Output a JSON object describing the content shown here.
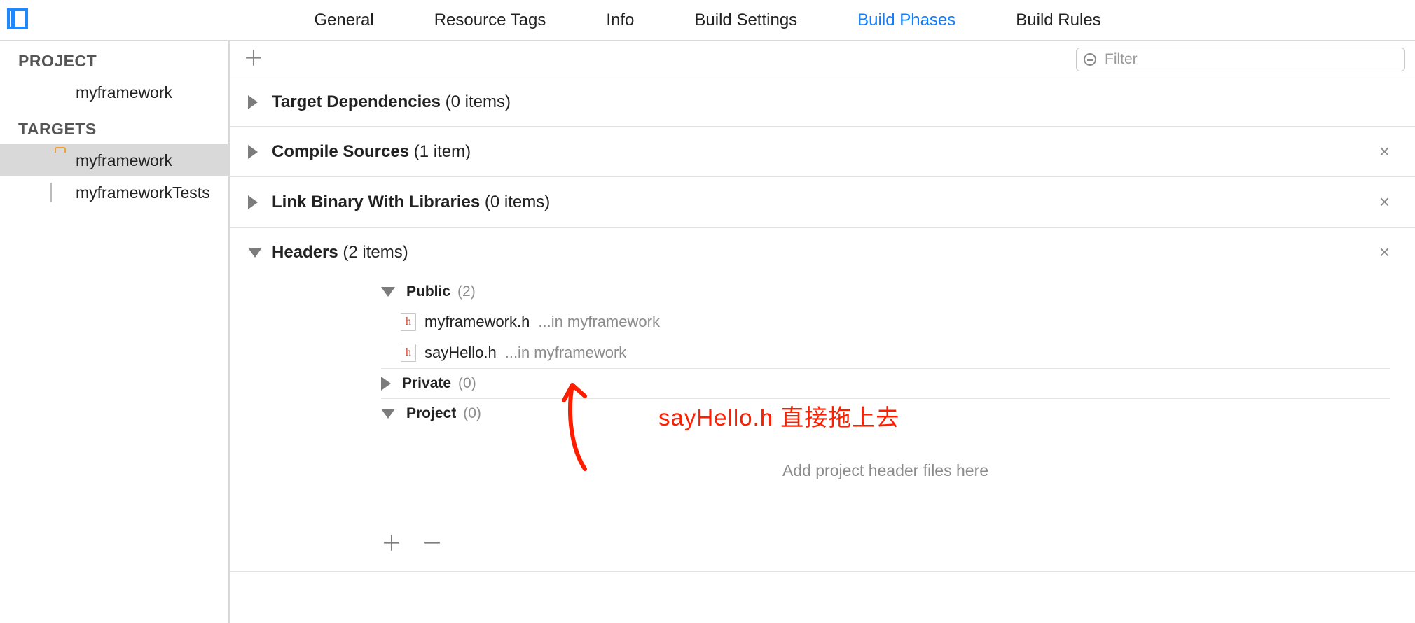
{
  "tabs": {
    "items": [
      {
        "label": "General"
      },
      {
        "label": "Resource Tags"
      },
      {
        "label": "Info"
      },
      {
        "label": "Build Settings"
      },
      {
        "label": "Build Phases"
      },
      {
        "label": "Build Rules"
      }
    ],
    "active_index": 4
  },
  "sidebar": {
    "sections": [
      {
        "title": "PROJECT",
        "items": [
          {
            "label": "myframework"
          }
        ]
      },
      {
        "title": "TARGETS",
        "items": [
          {
            "label": "myframework",
            "selected": true
          },
          {
            "label": "myframeworkTests"
          }
        ]
      }
    ]
  },
  "filter": {
    "placeholder": "Filter"
  },
  "phases": [
    {
      "title": "Target Dependencies",
      "count_label": "(0 items)",
      "expanded": false,
      "removable": false
    },
    {
      "title": "Compile Sources",
      "count_label": "(1 item)",
      "expanded": false,
      "removable": true
    },
    {
      "title": "Link Binary With Libraries",
      "count_label": "(0 items)",
      "expanded": false,
      "removable": true
    },
    {
      "title": "Headers",
      "count_label": "(2 items)",
      "expanded": true,
      "removable": true
    }
  ],
  "headers": {
    "groups": [
      {
        "name": "Public",
        "count_label": "(2)",
        "expanded": true,
        "files": [
          {
            "name": "myframework.h",
            "path": "...in myframework"
          },
          {
            "name": "sayHello.h",
            "path": "...in myframework"
          }
        ]
      },
      {
        "name": "Private",
        "count_label": "(0)",
        "expanded": false,
        "files": []
      },
      {
        "name": "Project",
        "count_label": "(0)",
        "expanded": true,
        "files": []
      }
    ],
    "drop_hint": "Add project header files here"
  },
  "annotation": {
    "text": "sayHello.h 直接拖上去"
  },
  "icons": {
    "close_glyph": "×",
    "plus_glyph": "＋",
    "minus_glyph": "－"
  }
}
